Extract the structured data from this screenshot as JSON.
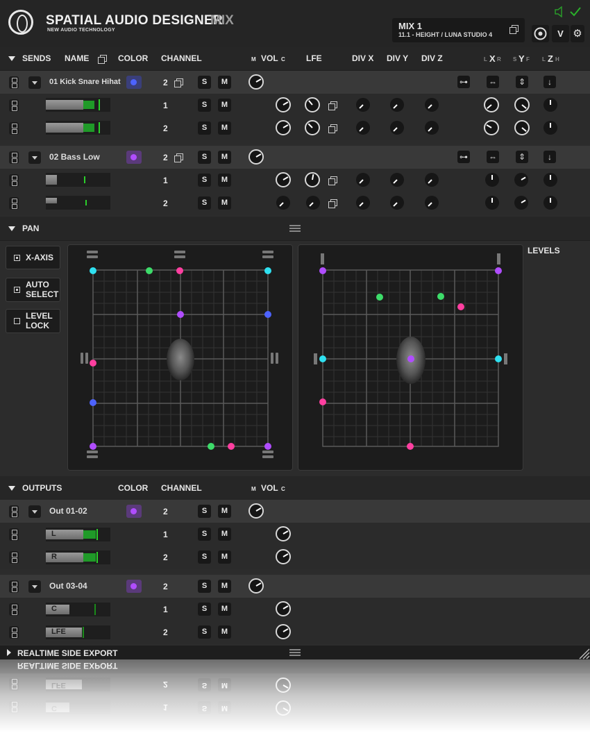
{
  "header": {
    "brand": "SPATIAL AUDIO DESIGNER",
    "brand_suffix": "MIX",
    "brand_tagline": "NEW AUDIO TECHNOLOGY",
    "mix_name": "MIX 1",
    "mix_format": "11.1 - HEIGHT / LUNA STUDIO 4",
    "v_label": "V"
  },
  "sends": {
    "title": "SENDS",
    "col_name": "NAME",
    "col_color": "COLOR",
    "col_channel": "CHANNEL",
    "col_m": "M",
    "col_vol": "VOL",
    "col_c": "C",
    "col_lfe": "LFE",
    "col_divx": "DIV X",
    "col_divy": "DIV Y",
    "col_divz": "DIV Z",
    "col_l1": "L",
    "col_x": "X",
    "col_r": "R",
    "col_s": "S",
    "col_y": "Y",
    "col_f": "F",
    "col_l2": "L",
    "col_z": "Z",
    "col_h": "H",
    "tracks": [
      {
        "name": "01 Kick Snare Hihat",
        "color": "#4d63ff",
        "channels": "2",
        "sub": [
          "1",
          "2"
        ]
      },
      {
        "name": "02 Bass Low",
        "color": "#b04dff",
        "channels": "2",
        "sub": [
          "1",
          "2"
        ]
      }
    ]
  },
  "solo_label": "S",
  "mute_label": "M",
  "pan": {
    "title": "PAN",
    "x_axis": "X-AXIS",
    "auto_select_1": "AUTO",
    "auto_select_2": "SELECT",
    "level_lock_1": "LEVEL",
    "level_lock_2": "LOCK",
    "levels": "LEVELS"
  },
  "outputs": {
    "title": "OUTPUTS",
    "col_color": "COLOR",
    "col_channel": "CHANNEL",
    "col_m": "M",
    "col_vol": "VOL",
    "col_c": "C",
    "groups": [
      {
        "name": "Out 01-02",
        "color": "#b04dff",
        "channels": "2",
        "sub": [
          {
            "label": "L",
            "num": "1"
          },
          {
            "label": "R",
            "num": "2"
          }
        ]
      },
      {
        "name": "Out 03-04",
        "color": "#b04dff",
        "channels": "2",
        "sub": [
          {
            "label": "C",
            "num": "1"
          },
          {
            "label": "LFE",
            "num": "2"
          }
        ]
      }
    ]
  },
  "realtime": {
    "title": "REALTIME SIDE EXPORT"
  },
  "colors": {
    "cyan": "#2fe0f0",
    "green": "#3ddc6a",
    "magenta": "#ff3fa0",
    "purple": "#b04dff",
    "blue": "#4d63ff"
  }
}
